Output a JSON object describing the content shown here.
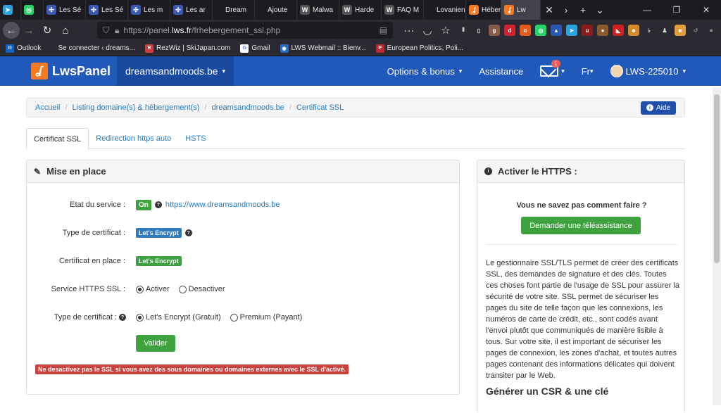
{
  "browser": {
    "tabs": [
      {
        "label": "",
        "icon": "telegram-icon",
        "color": "#2aa2e0"
      },
      {
        "label": "",
        "icon": "whatsapp-icon",
        "color": "#25d366"
      },
      {
        "label": "Les Sé",
        "icon": "slack-icon",
        "color": "#3b5ab8"
      },
      {
        "label": "Les Sé",
        "icon": "slack-icon",
        "color": "#3b5ab8"
      },
      {
        "label": "Les m",
        "icon": "slack-icon",
        "color": "#3b5ab8"
      },
      {
        "label": "Les ar",
        "icon": "slack-icon",
        "color": "#3b5ab8"
      },
      {
        "label": "Dream",
        "icon": "",
        "color": ""
      },
      {
        "label": "Ajoute",
        "icon": "",
        "color": ""
      },
      {
        "label": "Malwa",
        "icon": "wordpress-icon",
        "color": "#555"
      },
      {
        "label": "Harde",
        "icon": "wordpress-icon",
        "color": "#555"
      },
      {
        "label": "FAQ M",
        "icon": "wordpress-icon",
        "color": "#555"
      },
      {
        "label": "Lovaniens",
        "icon": "",
        "color": ""
      },
      {
        "label": "Héber",
        "icon": "lws-icon",
        "color": "#f47920"
      },
      {
        "label": "Lw",
        "icon": "lws-icon",
        "color": "#f47920"
      }
    ],
    "url_prefix": "https://panel.",
    "url_domain": "lws.fr",
    "url_path": "/frhebergement_ssl.php",
    "bookmarks": [
      {
        "label": "Outlook",
        "color": "#0a64c8",
        "icon": "outlook-icon"
      },
      {
        "label": "Se connecter ‹ dreams...",
        "color": "",
        "icon": ""
      },
      {
        "label": "RezWiz | SkiJapan.com",
        "color": "#d23b3b",
        "icon": "rezwiz-icon"
      },
      {
        "label": "Gmail",
        "color": "#fff",
        "icon": "google-icon"
      },
      {
        "label": "LWS Webmail :: Bienv...",
        "color": "#2a6ac4",
        "icon": "lws-webmail-icon"
      },
      {
        "label": "European Politics, Poli...",
        "color": "#c0272d",
        "icon": "politico-icon"
      }
    ]
  },
  "header": {
    "logo_text": "LwsPanel",
    "domain": "dreamsandmoods.be",
    "options": "Options & bonus",
    "assistance": "Assistance",
    "mail_count": "1",
    "lang": "Fr",
    "account": "LWS-225010"
  },
  "breadcrumb": {
    "items": [
      "Accueil",
      "Listing domaine(s) & hébergement(s)",
      "dreamsandmoods.be",
      "Certificat SSL"
    ],
    "help": "Aide"
  },
  "tabs": [
    "Certificat SSL",
    "Redirection https auto",
    "HSTS"
  ],
  "setup": {
    "title": "Mise en place",
    "etat_label": "Etat du service :",
    "etat_value": "On",
    "etat_url": "https://www.dreamsandmoods.be",
    "type_label": "Type de certificat :",
    "type_value": "Let's Encrypt",
    "cert_label": "Certificat en place :",
    "cert_value": "Let's Encrypt",
    "https_label": "Service HTTPS SSL :",
    "https_on": "Activer",
    "https_off": "Desactiver",
    "type2_label": "Type de certificat :",
    "type2_free": "Let's Encrypt (Gratuit)",
    "type2_paid": "Premium (Payant)",
    "submit": "Valider",
    "warning": "Ne desactivez pas le SSL si vous avez des sous domaines ou domaines externes avec le SSL d'activé."
  },
  "https_panel": {
    "title": "Activer le HTTPS :",
    "question": "Vous ne savez pas comment faire ?",
    "button": "Demander une téléassistance",
    "text": "Le gestionnaire SSL/TLS permet de créer des certificats SSL, des demandes de signature et des clés. Toutes ces choses font partie de l'usage de SSL pour assurer la sécurité de votre site. SSL permet de sécuriser les pages du site de telle façon que les connexions, les numéros de carte de crédit, etc., sont codés avant l'envoi plutôt que communiqués de manière lisible à tous. Sur votre site, il est important de sécuriser les pages de connexion, les zones d'achat, et toutes autres pages contenant des informations délicates qui doivent transiter par le Web.",
    "subtitle": "Générer un CSR & une clé"
  },
  "colors": {
    "brand": "#2159ba",
    "orange": "#f47920",
    "green": "#3ea33e",
    "blue_label": "#2f7bbf",
    "danger": "#c9433e"
  }
}
